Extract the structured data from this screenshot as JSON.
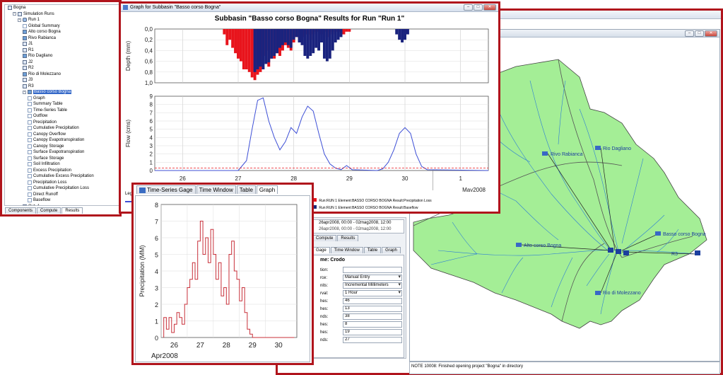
{
  "explorer": {
    "tree": [
      {
        "label": "Bogna",
        "level": 0,
        "icon": "folder"
      },
      {
        "label": "Simulation Runs",
        "level": 1,
        "icon": "folder",
        "exp": "-"
      },
      {
        "label": "Run 1",
        "level": 2,
        "icon": "run",
        "exp": "-"
      },
      {
        "label": "Global Summary",
        "level": 3,
        "icon": "res"
      },
      {
        "label": "Alto corso Bogna",
        "level": 3,
        "icon": "basin"
      },
      {
        "label": "Rivo Rabianca",
        "level": 3,
        "icon": "basin"
      },
      {
        "label": "J1",
        "level": 3,
        "icon": "node"
      },
      {
        "label": "R1",
        "level": 3,
        "icon": "node"
      },
      {
        "label": "Rio Dagliano",
        "level": 3,
        "icon": "basin"
      },
      {
        "label": "J2",
        "level": 3,
        "icon": "node"
      },
      {
        "label": "R2",
        "level": 3,
        "icon": "node"
      },
      {
        "label": "Rio di Molezzano",
        "level": 3,
        "icon": "basin"
      },
      {
        "label": "J3",
        "level": 3,
        "icon": "node"
      },
      {
        "label": "R3",
        "level": 3,
        "icon": "node"
      },
      {
        "label": "Basso corso Bogna",
        "level": 3,
        "icon": "basin",
        "exp": "-",
        "selected": true
      },
      {
        "label": "Graph",
        "level": 4,
        "icon": "res"
      },
      {
        "label": "Summary Table",
        "level": 4,
        "icon": "res"
      },
      {
        "label": "Time-Series Table",
        "level": 4,
        "icon": "res"
      },
      {
        "label": "Outflow",
        "level": 4,
        "icon": "res"
      },
      {
        "label": "Precipitation",
        "level": 4,
        "icon": "res"
      },
      {
        "label": "Cumulative Precipitation",
        "level": 4,
        "icon": "res"
      },
      {
        "label": "Canopy Overflow",
        "level": 4,
        "icon": "res"
      },
      {
        "label": "Canopy Evapotranspiration",
        "level": 4,
        "icon": "res"
      },
      {
        "label": "Canopy Storage",
        "level": 4,
        "icon": "res"
      },
      {
        "label": "Surface Evapotranspiration",
        "level": 4,
        "icon": "res"
      },
      {
        "label": "Surface Storage",
        "level": 4,
        "icon": "res"
      },
      {
        "label": "Soil Infiltration",
        "level": 4,
        "icon": "res"
      },
      {
        "label": "Excess Precipitation",
        "level": 4,
        "icon": "res"
      },
      {
        "label": "Cumulative Excess Precipitation",
        "level": 4,
        "icon": "res"
      },
      {
        "label": "Precipitation Loss",
        "level": 4,
        "icon": "res"
      },
      {
        "label": "Cumulative Precipitation Loss",
        "level": 4,
        "icon": "res"
      },
      {
        "label": "Direct Runoff",
        "level": 4,
        "icon": "res"
      },
      {
        "label": "Baseflow",
        "level": 4,
        "icon": "res"
      },
      {
        "label": "Out_1",
        "level": 3,
        "icon": "node"
      }
    ],
    "tabs": [
      "Components",
      "Compute",
      "Results"
    ],
    "active_tab": "Results"
  },
  "graph_window": {
    "title": "Graph for Subbasin \"Basso corso Bogna\"",
    "chart_title": "Subbasin \"Basso corso Bogna\" Results for Run \"Run 1\"",
    "depth_label": "Depth (mm)",
    "flow_label": "Flow (cms)",
    "depth_ticks": [
      "0,0",
      "0,2",
      "0,4",
      "0,6",
      "0,8",
      "1,0"
    ],
    "flow_ticks": [
      "0",
      "1",
      "2",
      "3",
      "4",
      "5",
      "6",
      "7",
      "8",
      "9"
    ],
    "x_ticks": [
      "26",
      "27",
      "28",
      "29",
      "30",
      "1"
    ],
    "month_label": "May2008",
    "legend_prefix": "Leg",
    "legend_items": [
      {
        "label": "Run:RUN 1 Element:BASSO CORSO BOGNA Result:Precipitation Loss",
        "color": "#e8141c"
      },
      {
        "label": "Run:RUN 1 Element:BASSO CORSO BOGNA Result:Baseflow",
        "color": "#1c2a7a"
      }
    ]
  },
  "gage_window": {
    "tabs": [
      "Time-Series Gage",
      "Time Window",
      "Table",
      "Graph"
    ],
    "active_tab": "Graph",
    "ylabel": "Precipitation (MM)",
    "y_ticks": [
      "0",
      "1",
      "2",
      "3",
      "4",
      "5",
      "6",
      "7",
      "8"
    ],
    "x_ticks": [
      "26",
      "27",
      "28",
      "29",
      "30"
    ],
    "month_label": "Apr2008"
  },
  "map_window": {
    "labels": [
      {
        "text": "Rivo Rabianca",
        "name": "map-label-rivo-rabianca"
      },
      {
        "text": "Rio Dagliano",
        "name": "map-label-rio-dagliano"
      },
      {
        "text": "Alto corso Bogna",
        "name": "map-label-alto-corso-bogna"
      },
      {
        "text": "Basso corso Bogna",
        "name": "map-label-basso-corso-bogna"
      },
      {
        "text": "Rio di Molezzano",
        "name": "map-label-rio-di-molezzano"
      },
      {
        "text": "R3",
        "name": "map-label-r3"
      }
    ],
    "colors": {
      "basin": "#a4ee96",
      "river": "#2e7fd4",
      "link": "#222"
    }
  },
  "component_editor": {
    "time_rows": [
      "26apr2008, 00:00 - 02mag2008, 12:00"
    ],
    "tabs": [
      "Compute",
      "Results"
    ],
    "gage_tabs": [
      "Gage",
      "Time Window",
      "Table",
      "Graph"
    ],
    "name_label": "me: Crodo",
    "fields": [
      {
        "label": "tion:",
        "value": "",
        "type": "text"
      },
      {
        "label": "rce:",
        "value": "Manual Entry",
        "type": "combo"
      },
      {
        "label": "nits:",
        "value": "Incremental Millimeters",
        "type": "combo"
      },
      {
        "label": "rval:",
        "value": "1 Hour",
        "type": "combo"
      },
      {
        "label": "hes:",
        "value": "46",
        "type": "text"
      },
      {
        "label": "hes:",
        "value": "13",
        "type": "text"
      },
      {
        "label": "nds:",
        "value": "38",
        "type": "text"
      },
      {
        "label": "hes:",
        "value": "8",
        "type": "text"
      },
      {
        "label": "hes:",
        "value": "19",
        "type": "text"
      },
      {
        "label": "nds:",
        "value": "27",
        "type": "text"
      }
    ]
  },
  "message_bar": {
    "line1": "NOTE 10008:  Finished opening project \"Bogna\" in directory"
  },
  "colors": {
    "frame": "#b0141c",
    "precip": "#e8141c",
    "loss": "#1a237e",
    "flow": "#3d4fd6"
  },
  "chart_data": [
    {
      "type": "bar",
      "title": "Subbasin \"Basso corso Bogna\" Results for Run \"Run 1\"",
      "ylabel": "Depth (mm)",
      "ylim": [
        1.0,
        0.0
      ],
      "x_range": [
        25.5,
        31.5
      ],
      "series": [
        {
          "name": "Precipitation",
          "color": "#e8141c",
          "x": [
            26.75,
            26.8,
            26.85,
            26.9,
            26.95,
            27.0,
            27.05,
            27.1,
            27.15,
            27.2,
            27.25,
            27.3,
            27.35,
            27.4,
            27.45,
            27.5,
            27.55,
            27.6,
            27.65,
            27.7,
            27.75,
            27.8,
            27.85,
            27.9,
            27.95,
            28.0,
            28.05,
            28.1,
            28.15,
            28.2,
            28.25,
            28.3,
            28.35,
            28.4,
            28.45,
            28.5,
            28.55,
            28.6,
            28.65,
            28.7,
            28.75,
            28.8,
            28.85,
            28.9,
            28.95,
            29.0,
            30.0
          ],
          "values": [
            0.1,
            0.3,
            0.2,
            0.35,
            0.45,
            0.55,
            0.6,
            0.75,
            0.75,
            0.8,
            0.9,
            0.95,
            0.85,
            0.8,
            0.5,
            0.4,
            0.7,
            0.55,
            0.55,
            0.45,
            0.5,
            0.4,
            0.3,
            0.35,
            0.4,
            0.25,
            0.15,
            0.2,
            0.15,
            0.1,
            0.1,
            0.2,
            0.1,
            0.05,
            0.05,
            0.1,
            0.05,
            0.15,
            0.05,
            0.1,
            0.05,
            0.05,
            0.05,
            0.1,
            0.05,
            0.05,
            0.05
          ]
        },
        {
          "name": "Precipitation Loss",
          "color": "#1a237e",
          "x": [
            27.3,
            27.35,
            27.4,
            27.45,
            27.5,
            27.55,
            27.6,
            27.65,
            27.7,
            27.75,
            27.8,
            27.85,
            27.9,
            27.95,
            28.0,
            28.05,
            28.1,
            28.15,
            28.2,
            28.25,
            28.3,
            28.35,
            28.4,
            28.45,
            28.5,
            28.55,
            28.6,
            28.65,
            28.7,
            28.75,
            28.8,
            28.85,
            29.85,
            29.9,
            29.95,
            30.0,
            30.05
          ],
          "values": [
            0.8,
            0.75,
            0.7,
            0.75,
            0.65,
            0.62,
            0.55,
            0.5,
            0.45,
            0.35,
            0.3,
            0.25,
            0.3,
            0.35,
            0.2,
            0.15,
            0.25,
            0.3,
            0.5,
            0.55,
            0.5,
            0.45,
            0.35,
            0.4,
            0.25,
            0.55,
            0.6,
            0.55,
            0.4,
            0.25,
            0.2,
            0.15,
            0.1,
            0.2,
            0.25,
            0.2,
            0.1
          ]
        }
      ]
    },
    {
      "type": "line",
      "ylabel": "Flow (cms)",
      "ylim": [
        0,
        9
      ],
      "x_range": [
        25.5,
        31.5
      ],
      "series": [
        {
          "name": "Outflow",
          "color": "#3d4fd6",
          "x": [
            25.5,
            27.0,
            27.15,
            27.25,
            27.35,
            27.45,
            27.55,
            27.65,
            27.75,
            27.85,
            27.95,
            28.05,
            28.15,
            28.25,
            28.35,
            28.45,
            28.55,
            28.65,
            28.75,
            28.85,
            28.95,
            29.05,
            29.5,
            29.6,
            29.7,
            29.8,
            29.9,
            30.0,
            30.1,
            30.2,
            30.3,
            30.4,
            31.5
          ],
          "values": [
            0,
            0,
            1.2,
            5,
            8.5,
            8.8,
            6,
            4,
            2.5,
            3.5,
            5.2,
            4.5,
            6.5,
            7.8,
            7.2,
            4.5,
            2.0,
            0.8,
            0.3,
            0.1,
            0.6,
            0.1,
            0,
            0.2,
            1.0,
            2.5,
            4.5,
            5.2,
            4.5,
            2.0,
            0.5,
            0.1,
            0
          ]
        },
        {
          "name": "Baseflow",
          "color": "#e8141c",
          "dashed": true,
          "x": [
            25.5,
            31.5
          ],
          "values": [
            0.3,
            0.3
          ]
        }
      ]
    },
    {
      "type": "line",
      "title": "",
      "ylabel": "Precipitation (MM)",
      "ylim": [
        0,
        8
      ],
      "x_range": [
        25.5,
        30.7
      ],
      "series": [
        {
          "name": "Precipitation",
          "color": "#c8303a",
          "step": true,
          "x": [
            25.6,
            25.7,
            25.8,
            25.9,
            26.0,
            26.1,
            26.2,
            26.3,
            26.4,
            26.5,
            26.6,
            26.7,
            26.8,
            26.9,
            27.0,
            27.1,
            27.2,
            27.3,
            27.4,
            27.5,
            27.6,
            27.7,
            27.8,
            27.9,
            28.0,
            28.1,
            28.2,
            28.3,
            28.4,
            28.5,
            28.6,
            28.7,
            28.8,
            28.9,
            29.0,
            30.6
          ],
          "values": [
            1.2,
            0.5,
            1.2,
            0.3,
            0.8,
            1.5,
            1.2,
            0.8,
            2.0,
            3.0,
            3.5,
            4.5,
            3.5,
            5.8,
            7.0,
            5.0,
            6.0,
            4.5,
            6.5,
            5.0,
            3.5,
            4.5,
            2.5,
            3.0,
            2.0,
            5.0,
            5.8,
            4.0,
            3.5,
            2.2,
            3.0,
            1.5,
            0.5,
            0.2,
            0,
            0
          ]
        }
      ]
    }
  ]
}
